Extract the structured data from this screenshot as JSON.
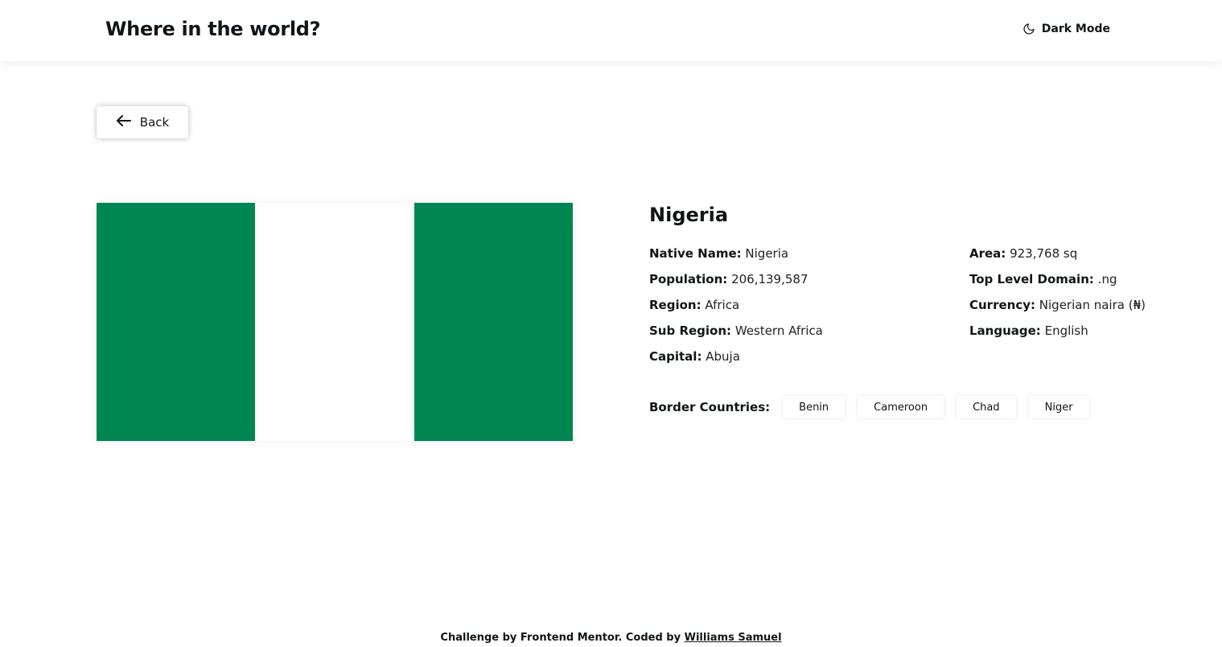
{
  "header": {
    "title": "Where in the world?",
    "mode_label": "Dark Mode",
    "mode_icon": "moon-icon"
  },
  "back": {
    "label": "Back",
    "icon": "arrow-left-icon"
  },
  "country": {
    "name": "Nigeria",
    "flag_colors": [
      "#008751",
      "#ffffff",
      "#008751"
    ],
    "left_details": [
      {
        "label": "Native Name:",
        "value": "Nigeria"
      },
      {
        "label": "Population:",
        "value": "206,139,587"
      },
      {
        "label": "Region:",
        "value": "Africa"
      },
      {
        "label": "Sub Region:",
        "value": "Western Africa"
      },
      {
        "label": "Capital:",
        "value": "Abuja"
      }
    ],
    "right_details": [
      {
        "label": "Area:",
        "value": "923,768 sq"
      },
      {
        "label": "Top Level Domain:",
        "value": ".ng"
      },
      {
        "label": "Currency:",
        "value": "Nigerian naira (₦)"
      },
      {
        "label": "Language:",
        "value": "English"
      }
    ],
    "border_label": "Border Countries:",
    "borders": [
      "Benin",
      "Cameroon",
      "Chad",
      "Niger"
    ]
  },
  "footer": {
    "text": "Challenge by Frontend Mentor. Coded by ",
    "author": "Williams Samuel"
  }
}
